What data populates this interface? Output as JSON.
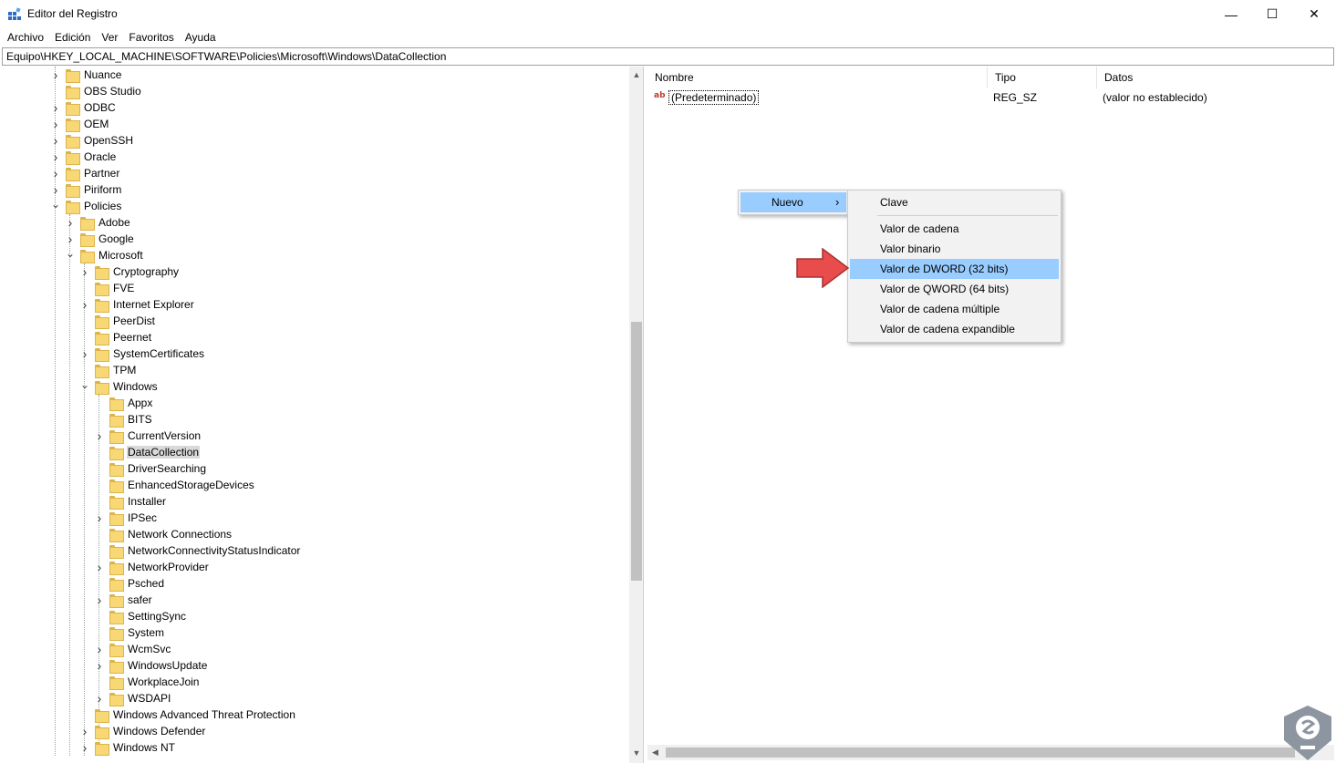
{
  "window": {
    "title": "Editor del Registro",
    "minimize_glyph": "—",
    "maximize_glyph": "☐",
    "close_glyph": "✕"
  },
  "menu": [
    "Archivo",
    "Edición",
    "Ver",
    "Favoritos",
    "Ayuda"
  ],
  "address": "Equipo\\HKEY_LOCAL_MACHINE\\SOFTWARE\\Policies\\Microsoft\\Windows\\DataCollection",
  "tree": [
    {
      "label": "Nuance",
      "depth": 0,
      "chevron": "right"
    },
    {
      "label": "OBS Studio",
      "depth": 0,
      "chevron": "none"
    },
    {
      "label": "ODBC",
      "depth": 0,
      "chevron": "right"
    },
    {
      "label": "OEM",
      "depth": 0,
      "chevron": "right"
    },
    {
      "label": "OpenSSH",
      "depth": 0,
      "chevron": "right"
    },
    {
      "label": "Oracle",
      "depth": 0,
      "chevron": "right"
    },
    {
      "label": "Partner",
      "depth": 0,
      "chevron": "right"
    },
    {
      "label": "Piriform",
      "depth": 0,
      "chevron": "right"
    },
    {
      "label": "Policies",
      "depth": 0,
      "chevron": "down"
    },
    {
      "label": "Adobe",
      "depth": 1,
      "chevron": "right"
    },
    {
      "label": "Google",
      "depth": 1,
      "chevron": "right"
    },
    {
      "label": "Microsoft",
      "depth": 1,
      "chevron": "down"
    },
    {
      "label": "Cryptography",
      "depth": 2,
      "chevron": "right"
    },
    {
      "label": "FVE",
      "depth": 2,
      "chevron": "none"
    },
    {
      "label": "Internet Explorer",
      "depth": 2,
      "chevron": "right"
    },
    {
      "label": "PeerDist",
      "depth": 2,
      "chevron": "none"
    },
    {
      "label": "Peernet",
      "depth": 2,
      "chevron": "none"
    },
    {
      "label": "SystemCertificates",
      "depth": 2,
      "chevron": "right"
    },
    {
      "label": "TPM",
      "depth": 2,
      "chevron": "none"
    },
    {
      "label": "Windows",
      "depth": 2,
      "chevron": "down"
    },
    {
      "label": "Appx",
      "depth": 3,
      "chevron": "none"
    },
    {
      "label": "BITS",
      "depth": 3,
      "chevron": "none"
    },
    {
      "label": "CurrentVersion",
      "depth": 3,
      "chevron": "right"
    },
    {
      "label": "DataCollection",
      "depth": 3,
      "chevron": "none",
      "selected": true
    },
    {
      "label": "DriverSearching",
      "depth": 3,
      "chevron": "none"
    },
    {
      "label": "EnhancedStorageDevices",
      "depth": 3,
      "chevron": "none"
    },
    {
      "label": "Installer",
      "depth": 3,
      "chevron": "none"
    },
    {
      "label": "IPSec",
      "depth": 3,
      "chevron": "right"
    },
    {
      "label": "Network Connections",
      "depth": 3,
      "chevron": "none"
    },
    {
      "label": "NetworkConnectivityStatusIndicator",
      "depth": 3,
      "chevron": "none"
    },
    {
      "label": "NetworkProvider",
      "depth": 3,
      "chevron": "right"
    },
    {
      "label": "Psched",
      "depth": 3,
      "chevron": "none"
    },
    {
      "label": "safer",
      "depth": 3,
      "chevron": "right"
    },
    {
      "label": "SettingSync",
      "depth": 3,
      "chevron": "none"
    },
    {
      "label": "System",
      "depth": 3,
      "chevron": "none"
    },
    {
      "label": "WcmSvc",
      "depth": 3,
      "chevron": "right"
    },
    {
      "label": "WindowsUpdate",
      "depth": 3,
      "chevron": "right"
    },
    {
      "label": "WorkplaceJoin",
      "depth": 3,
      "chevron": "none"
    },
    {
      "label": "WSDAPI",
      "depth": 3,
      "chevron": "right"
    },
    {
      "label": "Windows Advanced Threat Protection",
      "depth": 2,
      "chevron": "none"
    },
    {
      "label": "Windows Defender",
      "depth": 2,
      "chevron": "right"
    },
    {
      "label": "Windows NT",
      "depth": 2,
      "chevron": "right"
    }
  ],
  "values": {
    "headers": {
      "name": "Nombre",
      "type": "Tipo",
      "data": "Datos"
    },
    "rows": [
      {
        "icon": "ab",
        "name": "(Predeterminado)",
        "type": "REG_SZ",
        "data": "(valor no establecido)"
      }
    ]
  },
  "context_menu": {
    "parent_item": "Nuevo",
    "parent_chevron": "›",
    "submenu": {
      "items": [
        "Clave",
        "Valor de cadena",
        "Valor binario",
        "Valor de DWORD (32 bits)",
        "Valor de QWORD (64 bits)",
        "Valor de cadena múltiple",
        "Valor de cadena expandible"
      ],
      "highlighted_index": 3
    }
  },
  "colors": {
    "highlight": "#99ccff",
    "arrow": "#e84c4c",
    "logo": "#8d96a0"
  }
}
